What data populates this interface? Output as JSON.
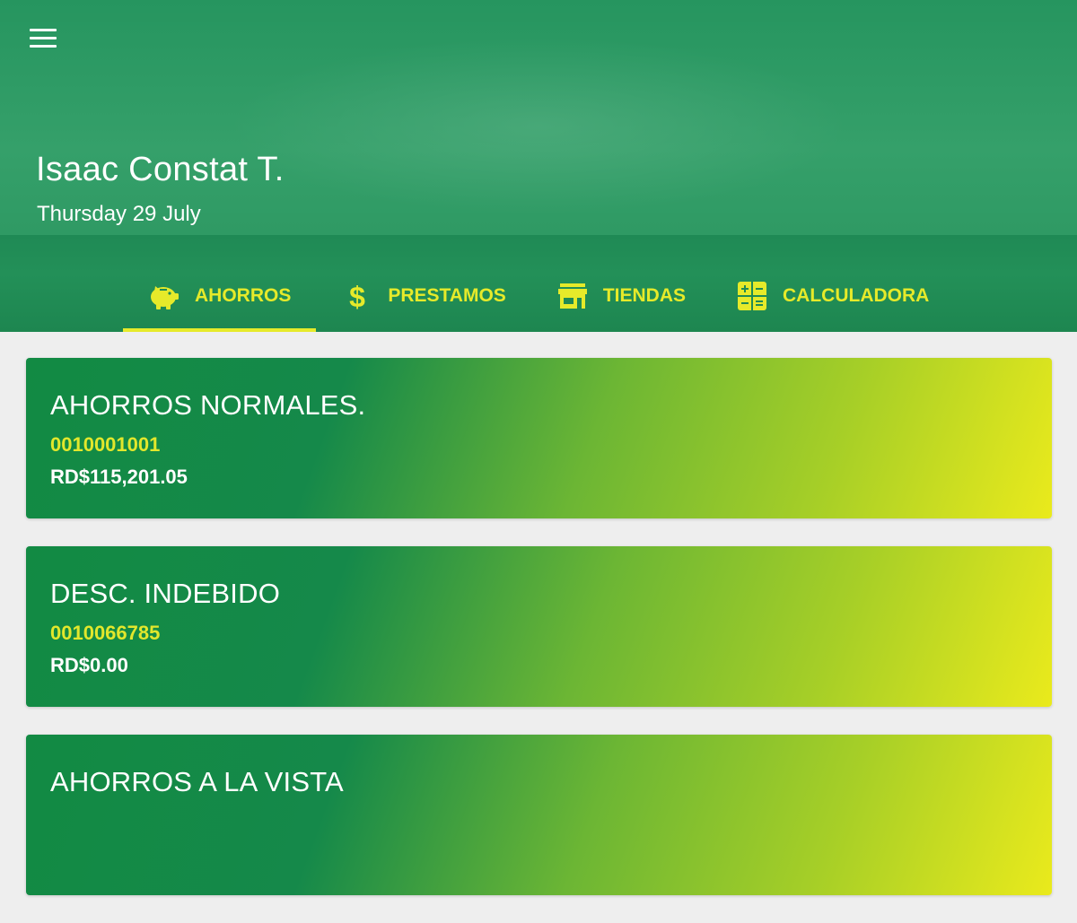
{
  "user": {
    "name": "Isaac Constat T.",
    "date": "Thursday 29 July"
  },
  "tabs": [
    {
      "label": "AHORROS",
      "icon": "piggy-bank-icon",
      "active": true
    },
    {
      "label": "PRESTAMOS",
      "icon": "dollar-icon",
      "active": false
    },
    {
      "label": "TIENDAS",
      "icon": "store-icon",
      "active": false
    },
    {
      "label": "CALCULADORA",
      "icon": "calculator-icon",
      "active": false
    }
  ],
  "accounts": [
    {
      "title": "AHORROS NORMALES.",
      "number": "0010001001",
      "balance": "RD$115,201.05"
    },
    {
      "title": "DESC. INDEBIDO",
      "number": "0010066785",
      "balance": "RD$0.00"
    },
    {
      "title": "AHORROS A LA VISTA",
      "number": "",
      "balance": ""
    }
  ],
  "colors": {
    "accent": "#e6ea2a",
    "header_green": "#2f9a64",
    "card_start": "#128a43",
    "card_end": "#eaea1c",
    "background": "#eeeeee"
  }
}
